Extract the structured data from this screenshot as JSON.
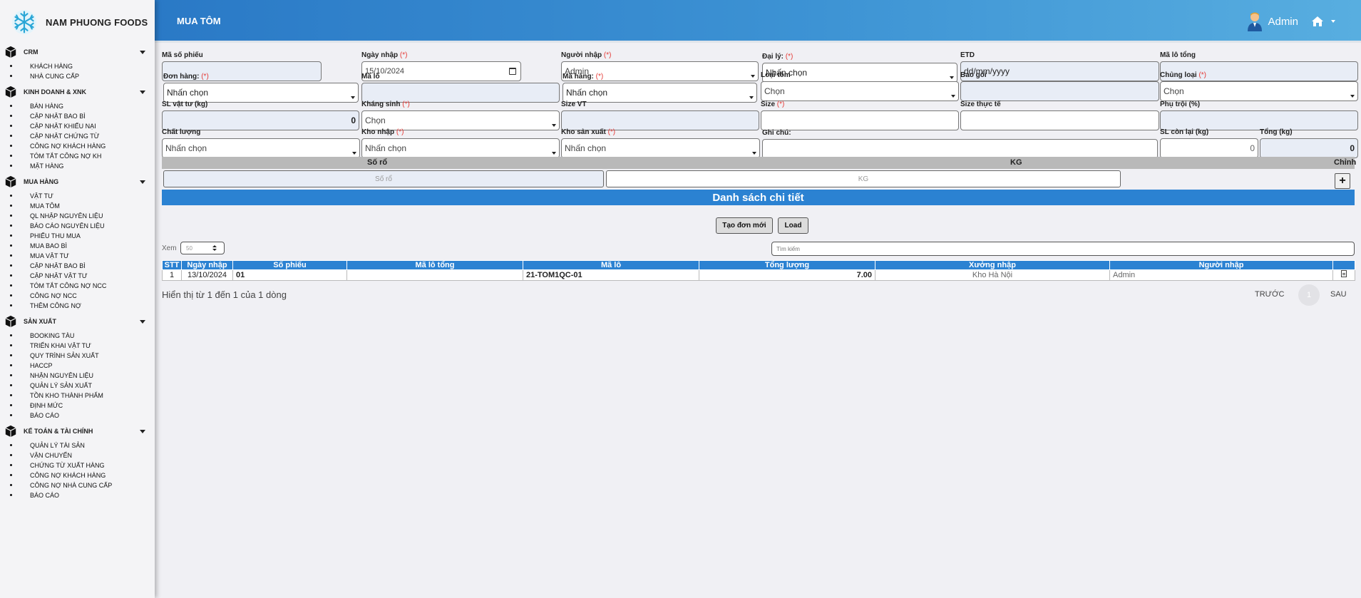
{
  "brand": {
    "name": "NAM PHUONG FOODS"
  },
  "header": {
    "title": "MUA TÔM",
    "user": "Admin"
  },
  "sidebar": {
    "sections": [
      {
        "title": "CRM",
        "items": [
          "KHÁCH HÀNG",
          "NHÀ CUNG CẤP"
        ]
      },
      {
        "title": "KINH DOANH & XNK",
        "items": [
          "BÁN HÀNG",
          "CẬP NHẬT BAO BÌ",
          "CẬP NHẬT KHIẾU NẠI",
          "CẬP NHẬT CHỨNG TỪ",
          "CÔNG NỢ KHÁCH HÀNG",
          "TÓM TẮT CÔNG NỢ KH",
          "MẶT HÀNG"
        ]
      },
      {
        "title": "MUA HÀNG",
        "items": [
          "VẬT TƯ",
          "MUA TÔM",
          "QL NHẬP NGUYÊN LIỆU",
          "BÁO CÁO NGUYÊN LIỆU",
          "PHIẾU THU MUA",
          "MUA BAO BÌ",
          "MUA VẬT TƯ",
          "CẬP NHẬT BAO BÌ",
          "CẬP NHẬT VẬT TƯ",
          "TÓM TẮT CÔNG NỢ NCC",
          "CÔNG NỢ NCC",
          "THÊM CÔNG NỢ"
        ]
      },
      {
        "title": "SẢN XUẤT",
        "items": [
          "BOOKING TÀU",
          "TRIỂN KHAI VẬT TƯ",
          "QUY TRÌNH SẢN XUẤT",
          "HACCP",
          "NHẬN NGUYÊN LIỆU",
          "QUẢN LÝ SẢN XUẤT",
          "TỒN KHO THÀNH PHẨM",
          "ĐỊNH MỨC",
          "BÁO CÁO"
        ]
      },
      {
        "title": "KẾ TOÁN & TÀI CHÍNH",
        "items": [
          "QUẢN LÝ TÀI SẢN",
          "VẬN CHUYỂN",
          "CHỨNG TỪ XUẤT HÀNG",
          "CÔNG NỢ KHÁCH HÀNG",
          "CÔNG NỢ NHÀ CUNG CẤP",
          "BÁO CÁO"
        ]
      }
    ]
  },
  "form": {
    "ma_so_phieu": {
      "label": "Mã số phiếu",
      "value": ""
    },
    "ngay_nhap": {
      "label": "Ngày nhập",
      "req": "(*)",
      "value": "15/10/2024"
    },
    "nguoi_nhap": {
      "label": "Người nhập",
      "req": "(*)",
      "value": "Admin"
    },
    "dai_ly": {
      "label": "Đại lý:",
      "req": "(*)",
      "value": "Nhấn chọn"
    },
    "etd": {
      "label": "ETD",
      "value": "dd/mm/yyyy"
    },
    "ma_lo_tong": {
      "label": "Mã lô tổng",
      "value": ""
    },
    "don_hang": {
      "label": "Đơn hàng:",
      "req": "(*)",
      "value": "Nhấn chọn"
    },
    "ma_lo": {
      "label": "Mã lô",
      "value": ""
    },
    "ma_hang": {
      "label": "Mã hàng:",
      "req": "(*)",
      "value": "Nhấn chọn"
    },
    "loai_tom": {
      "label": "Loại tôm",
      "value": "Chọn"
    },
    "bao_goi": {
      "label": "Bao gói",
      "value": ""
    },
    "chung_loai": {
      "label": "Chủng loại",
      "req": "(*)",
      "value": "Chọn"
    },
    "sl_vat_tu": {
      "label": "SL vật tư (kg)",
      "value": "0"
    },
    "khang_sinh": {
      "label": "Kháng sinh",
      "req": "(*)",
      "value": "Chọn"
    },
    "size_vt": {
      "label": "Size VT",
      "value": ""
    },
    "size": {
      "label": "Size",
      "req": "(*)",
      "value": ""
    },
    "size_thuc_te": {
      "label": "Size thực tế",
      "value": ""
    },
    "phu_troi": {
      "label": "Phụ trội (%)",
      "value": ""
    },
    "chat_luong": {
      "label": "Chất lượng",
      "value": "Nhấn chọn"
    },
    "kho_nhap": {
      "label": "Kho nhập",
      "req": "(*)",
      "value": "Nhấn chọn"
    },
    "kho_san_xuat": {
      "label": "Kho sản xuất",
      "req": "(*)",
      "value": "Nhấn chọn"
    },
    "ghi_chu": {
      "label": "Ghi chú:",
      "value": ""
    },
    "sl_con_lai": {
      "label": "SL còn lại (kg)",
      "value": "0"
    },
    "tong": {
      "label": "Tổng (kg)",
      "value": "0"
    }
  },
  "grid": {
    "col_so_ro": "Số rổ",
    "col_kg": "KG",
    "col_chinh": "Chỉnh",
    "so_ro_placeholder": "Số rổ",
    "kg_placeholder": "KG",
    "add_label": "+"
  },
  "detail": {
    "title": "Danh sách chi tiết"
  },
  "buttons": {
    "create": "Tạo đơn mới",
    "load": "Load"
  },
  "list": {
    "view_label": "Xem",
    "view_value": "50",
    "search_placeholder": "Tìm kiếm",
    "columns": [
      "STT",
      "Ngày nhập",
      "Số phiếu",
      "Mã lô tổng",
      "Mã lô",
      "Tổng lượng",
      "Xưởng nhập",
      "Người nhập"
    ],
    "rows": [
      {
        "stt": "1",
        "ngay_nhap": "13/10/2024",
        "so_phieu": "01",
        "ma_lo_tong": "",
        "ma_lo": "21-TOM1QC-01",
        "tong_luong": "7.00",
        "xuong_nhap": "Kho Hà Nội",
        "nguoi_nhap": "Admin"
      }
    ],
    "info": "Hiển thị từ 1 đến 1 của 1 dòng",
    "prev": "TRƯỚC",
    "page": "1",
    "next": "SAU"
  },
  "colors": {
    "header_start": "#2a79c6",
    "header_end": "#58aee0",
    "accent": "#2b82d2",
    "required": "#e53935"
  }
}
